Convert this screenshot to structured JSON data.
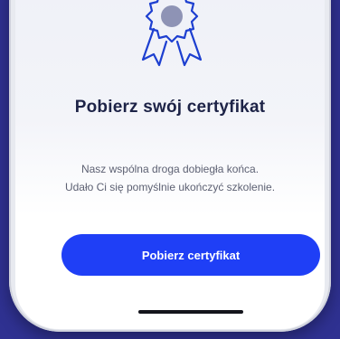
{
  "screen": {
    "title": "Pobierz swój certyfikat",
    "description_lines": [
      "Nasz wspólna droga dobiegła końca.",
      "Udało Ci się pomyślnie ukończyć szkolenie."
    ],
    "primary_button_label": "Pobierz certyfikat",
    "icon": "award-ribbon-icon"
  },
  "colors": {
    "background": "#2f3191",
    "accent": "#1f3ff6",
    "title": "#1d2347",
    "body_text": "#5d6173"
  }
}
